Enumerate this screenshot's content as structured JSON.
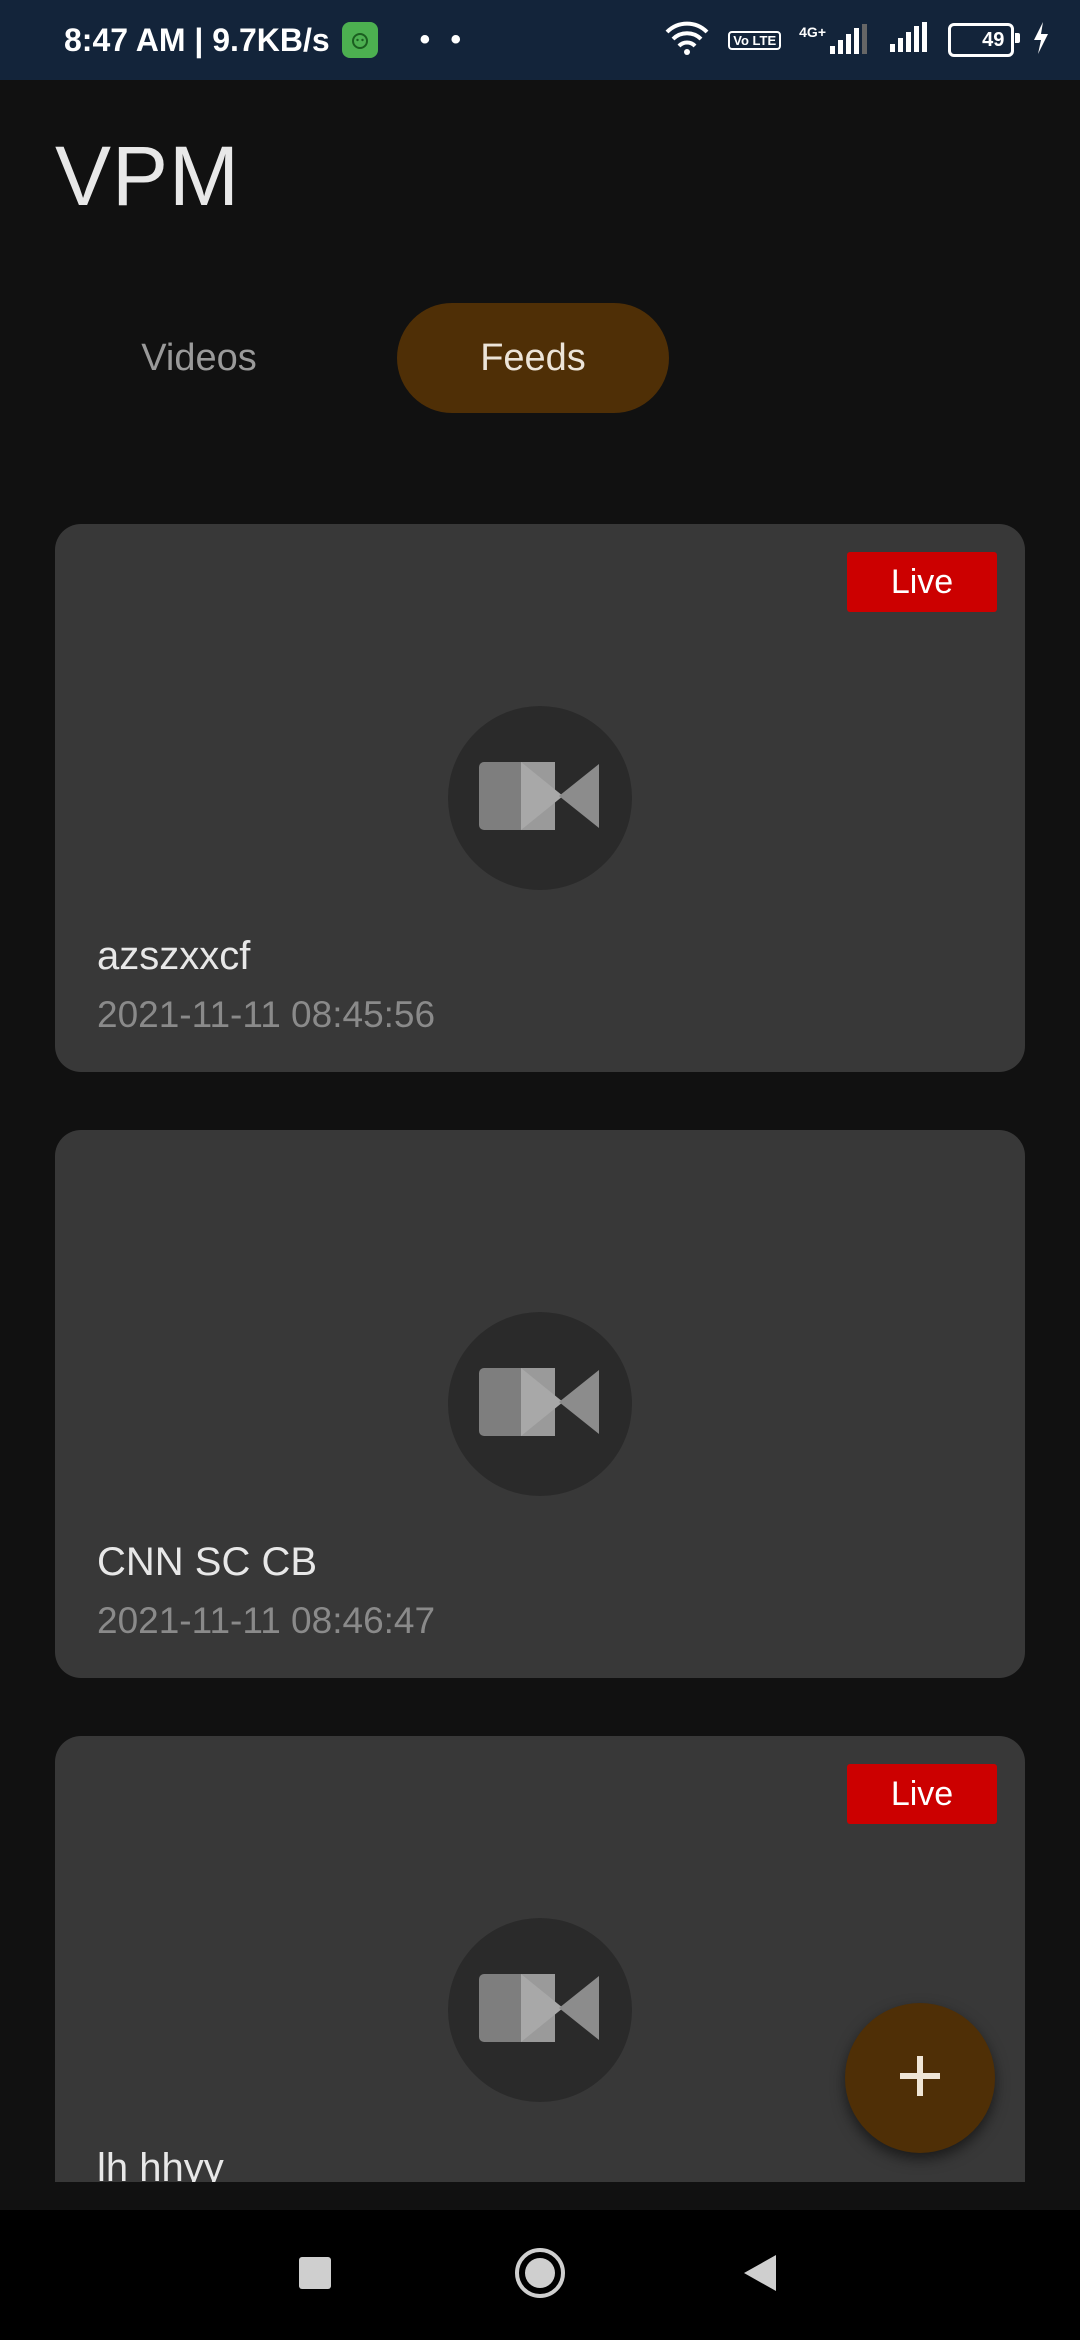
{
  "status_bar": {
    "time_speed": "8:47 AM | 9.7KB/s",
    "dots": "• •",
    "network_type": "4G+",
    "volte_label": "Vo LTE",
    "battery_level": "49",
    "battery_fraction": 0.49
  },
  "app": {
    "title": "VPM"
  },
  "tabs": [
    {
      "label": "Videos",
      "selected": false
    },
    {
      "label": "Feeds",
      "selected": true
    }
  ],
  "feeds": [
    {
      "name": "azszxxcf",
      "date": "2021-11-11 08:45:56",
      "live": true
    },
    {
      "name": "CNN SC CB",
      "date": "2021-11-11 08:46:47",
      "live": false
    },
    {
      "name": "lh hhyy",
      "date": "",
      "live": true
    }
  ],
  "live_label": "Live",
  "fab": {
    "icon": "plus-icon"
  },
  "nav": {
    "recents_icon": "square-icon",
    "home_icon": "circle-icon",
    "back_icon": "triangle-back-icon"
  },
  "colors": {
    "accent": "#4f2f06",
    "live": "#cc0000",
    "card": "#383838",
    "background": "#111111"
  }
}
